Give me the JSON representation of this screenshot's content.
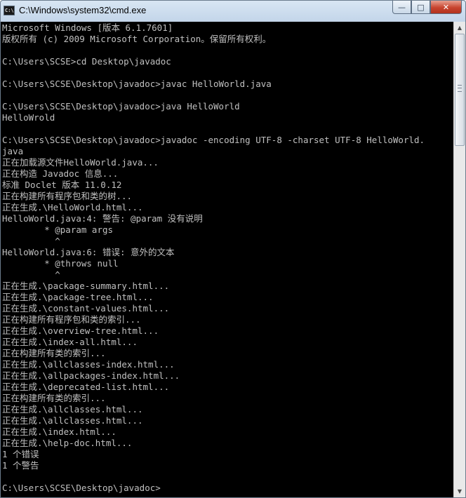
{
  "window": {
    "title": "C:\\Windows\\system32\\cmd.exe",
    "icon": "cmd-icon",
    "icon_text": "C:\\",
    "controls": {
      "minimize": "—",
      "maximize": "□",
      "close": "✕"
    }
  },
  "scrollbar": {
    "up": "▲",
    "down": "▼"
  },
  "console": {
    "lines": [
      "Microsoft Windows [版本 6.1.7601]",
      "版权所有 (c) 2009 Microsoft Corporation。保留所有权利。",
      "",
      "C:\\Users\\SCSE>cd Desktop\\javadoc",
      "",
      "C:\\Users\\SCSE\\Desktop\\javadoc>javac HelloWorld.java",
      "",
      "C:\\Users\\SCSE\\Desktop\\javadoc>java HelloWorld",
      "HelloWrold",
      "",
      "C:\\Users\\SCSE\\Desktop\\javadoc>javadoc -encoding UTF-8 -charset UTF-8 HelloWorld.",
      "java",
      "正在加载源文件HelloWorld.java...",
      "正在构造 Javadoc 信息...",
      "标准 Doclet 版本 11.0.12",
      "正在构建所有程序包和类的树...",
      "正在生成.\\HelloWorld.html...",
      "HelloWorld.java:4: 警告: @param 没有说明",
      "        * @param args",
      "          ^",
      "HelloWorld.java:6: 错误: 意外的文本",
      "        * @throws null",
      "          ^",
      "正在生成.\\package-summary.html...",
      "正在生成.\\package-tree.html...",
      "正在生成.\\constant-values.html...",
      "正在构建所有程序包和类的索引...",
      "正在生成.\\overview-tree.html...",
      "正在生成.\\index-all.html...",
      "正在构建所有类的索引...",
      "正在生成.\\allclasses-index.html...",
      "正在生成.\\allpackages-index.html...",
      "正在生成.\\deprecated-list.html...",
      "正在构建所有类的索引...",
      "正在生成.\\allclasses.html...",
      "正在生成.\\allclasses.html...",
      "正在生成.\\index.html...",
      "正在生成.\\help-doc.html...",
      "1 个错误",
      "1 个警告",
      "",
      "C:\\Users\\SCSE\\Desktop\\javadoc>"
    ]
  }
}
